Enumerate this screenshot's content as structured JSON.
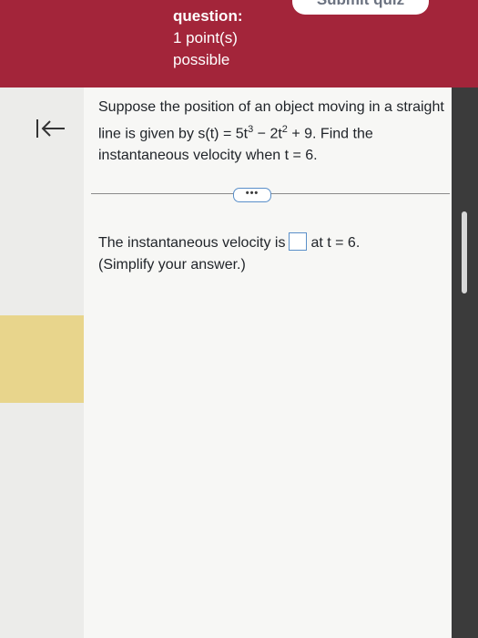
{
  "header": {
    "question_label": "question:",
    "points": "1 point(s)",
    "possible": "possible",
    "submit_label": "Submit quiz"
  },
  "nav": {
    "collapse_icon": "collapse-left-icon"
  },
  "question": {
    "text_part1": "Suppose the position of an object moving in a straight line is given by s(t) = 5t",
    "exp1": "3",
    "text_part2": " − 2t",
    "exp2": "2",
    "text_part3": " + 9.  Find the instantaneous velocity when t = 6."
  },
  "more_button_label": "•••",
  "answer": {
    "prefix": "The instantaneous velocity is",
    "suffix": "at t = 6.",
    "hint": "(Simplify your answer.)"
  },
  "colors": {
    "header_bg": "#a3253a",
    "accent": "#5a8fc9",
    "highlight": "#e8d58c"
  }
}
